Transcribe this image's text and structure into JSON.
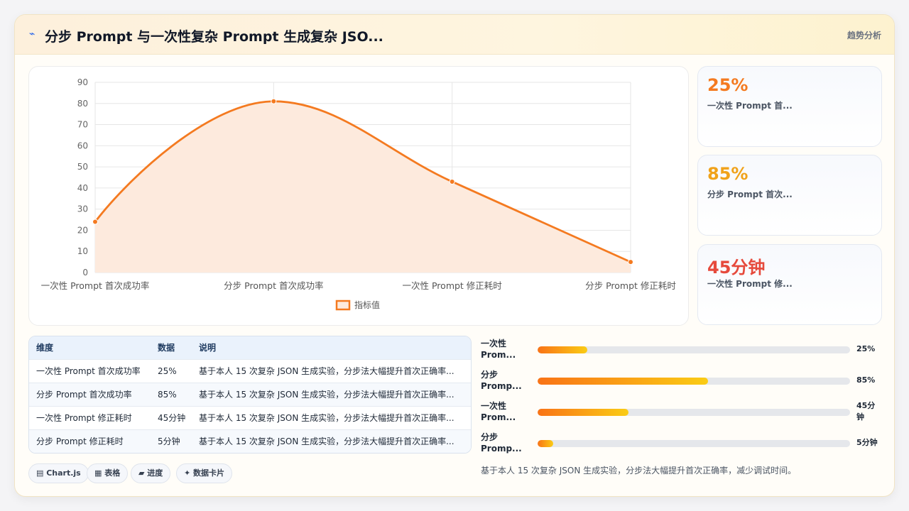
{
  "header": {
    "icon": "trend-line-icon",
    "title": "分步 Prompt 与一次性复杂 Prompt 生成复杂 JSO...",
    "tag": "趋势分析"
  },
  "chart_data": {
    "type": "line",
    "area": true,
    "smooth": true,
    "categories": [
      "一次性 Prompt 首次成功率",
      "分步 Prompt 首次成功率",
      "一次性 Prompt 修正耗时",
      "分步 Prompt 修正耗时"
    ],
    "series": [
      {
        "name": "指标值",
        "values": [
          24,
          81,
          43,
          5
        ],
        "color": "#f47a20",
        "fill": "#fdeadd"
      }
    ],
    "ylim": [
      0,
      90
    ],
    "yticks": [
      0,
      10,
      20,
      30,
      40,
      50,
      60,
      70,
      80,
      90
    ],
    "grid": true,
    "legend": "bottom"
  },
  "stats": [
    {
      "value": "25%",
      "label": "一次性 Prompt 首...",
      "color": "#f47a20"
    },
    {
      "value": "85%",
      "label": "分步 Prompt 首次...",
      "color": "#f0a21a"
    },
    {
      "value": "45分钟",
      "label": "一次性 Prompt 修...",
      "color": "#e64a3c"
    }
  ],
  "table": {
    "headers": [
      "维度",
      "数据",
      "说明"
    ],
    "rows": [
      [
        "一次性 Prompt 首次成功率",
        "25%",
        "基于本人 15 次复杂 JSON 生成实验，分步法大幅提升首次正确率..."
      ],
      [
        "分步 Prompt 首次成功率",
        "85%",
        "基于本人 15 次复杂 JSON 生成实验，分步法大幅提升首次正确率..."
      ],
      [
        "一次性 Prompt 修正耗时",
        "45分钟",
        "基于本人 15 次复杂 JSON 生成实验，分步法大幅提升首次正确率..."
      ],
      [
        "分步 Prompt 修正耗时",
        "5分钟",
        "基于本人 15 次复杂 JSON 生成实验，分步法大幅提升首次正确率..."
      ]
    ]
  },
  "chips": [
    "▤ Chart.js",
    "▦ 表格",
    "▰ 进度",
    "✦ 数据卡片"
  ],
  "progress": [
    {
      "label_line1": "一次性",
      "label_line2": "Prom...",
      "value": "25%",
      "fraction": 0.16
    },
    {
      "label_line1": "分步",
      "label_line2": "Promp...",
      "value": "85%",
      "fraction": 0.545
    },
    {
      "label_line1": "一次性",
      "label_line2": "Prom...",
      "value_line1": "45分",
      "value_line2": "钟",
      "fraction": 0.29
    },
    {
      "label_line1": "分步",
      "label_line2": "Promp...",
      "value": "5分钟",
      "fraction": 0.05
    }
  ],
  "note": "基于本人 15 次复杂 JSON 生成实验，分步法大幅提升首次正确率，减少调试时间。"
}
